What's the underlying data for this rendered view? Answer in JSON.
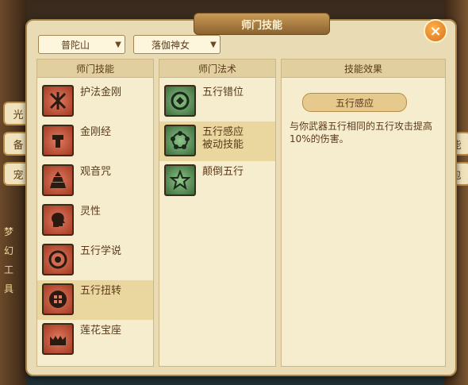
{
  "window": {
    "title": "师门技能",
    "close_symbol": "×"
  },
  "filters": {
    "school": "普陀山",
    "role": "落伽神女",
    "arrow": "▼"
  },
  "background": {
    "signs": [
      "光",
      "备",
      "宠",
      "能",
      "包"
    ],
    "vertical_text": [
      "梦",
      "幻",
      "工",
      "具"
    ]
  },
  "panels": {
    "skills": {
      "header": "师门技能",
      "items": [
        {
          "label": "护法金刚",
          "icon": "vajra-icon"
        },
        {
          "label": "金刚经",
          "icon": "sutra-icon"
        },
        {
          "label": "观音咒",
          "icon": "pagoda-icon"
        },
        {
          "label": "灵性",
          "icon": "mind-icon"
        },
        {
          "label": "五行学说",
          "icon": "five-elements-icon"
        },
        {
          "label": "五行扭转",
          "icon": "twist-icon",
          "selected": true
        },
        {
          "label": "莲花宝座",
          "icon": "lotus-throne-icon"
        }
      ]
    },
    "spells": {
      "header": "师门法术",
      "items": [
        {
          "label": "五行错位",
          "icon": "element-swap-icon"
        },
        {
          "label": "五行感应",
          "sub": "被动技能",
          "icon": "element-sense-icon",
          "selected": true
        },
        {
          "label": "颠倒五行",
          "icon": "star-reverse-icon"
        }
      ]
    },
    "effect": {
      "header": "技能效果",
      "title": "五行感应",
      "description": "与你武器五行相同的五行攻击提高10%的伤害。"
    }
  },
  "colors": {
    "selected_row": "#ead79f",
    "panel_bg": "#f6edcf",
    "text": "#5a3a1a"
  }
}
